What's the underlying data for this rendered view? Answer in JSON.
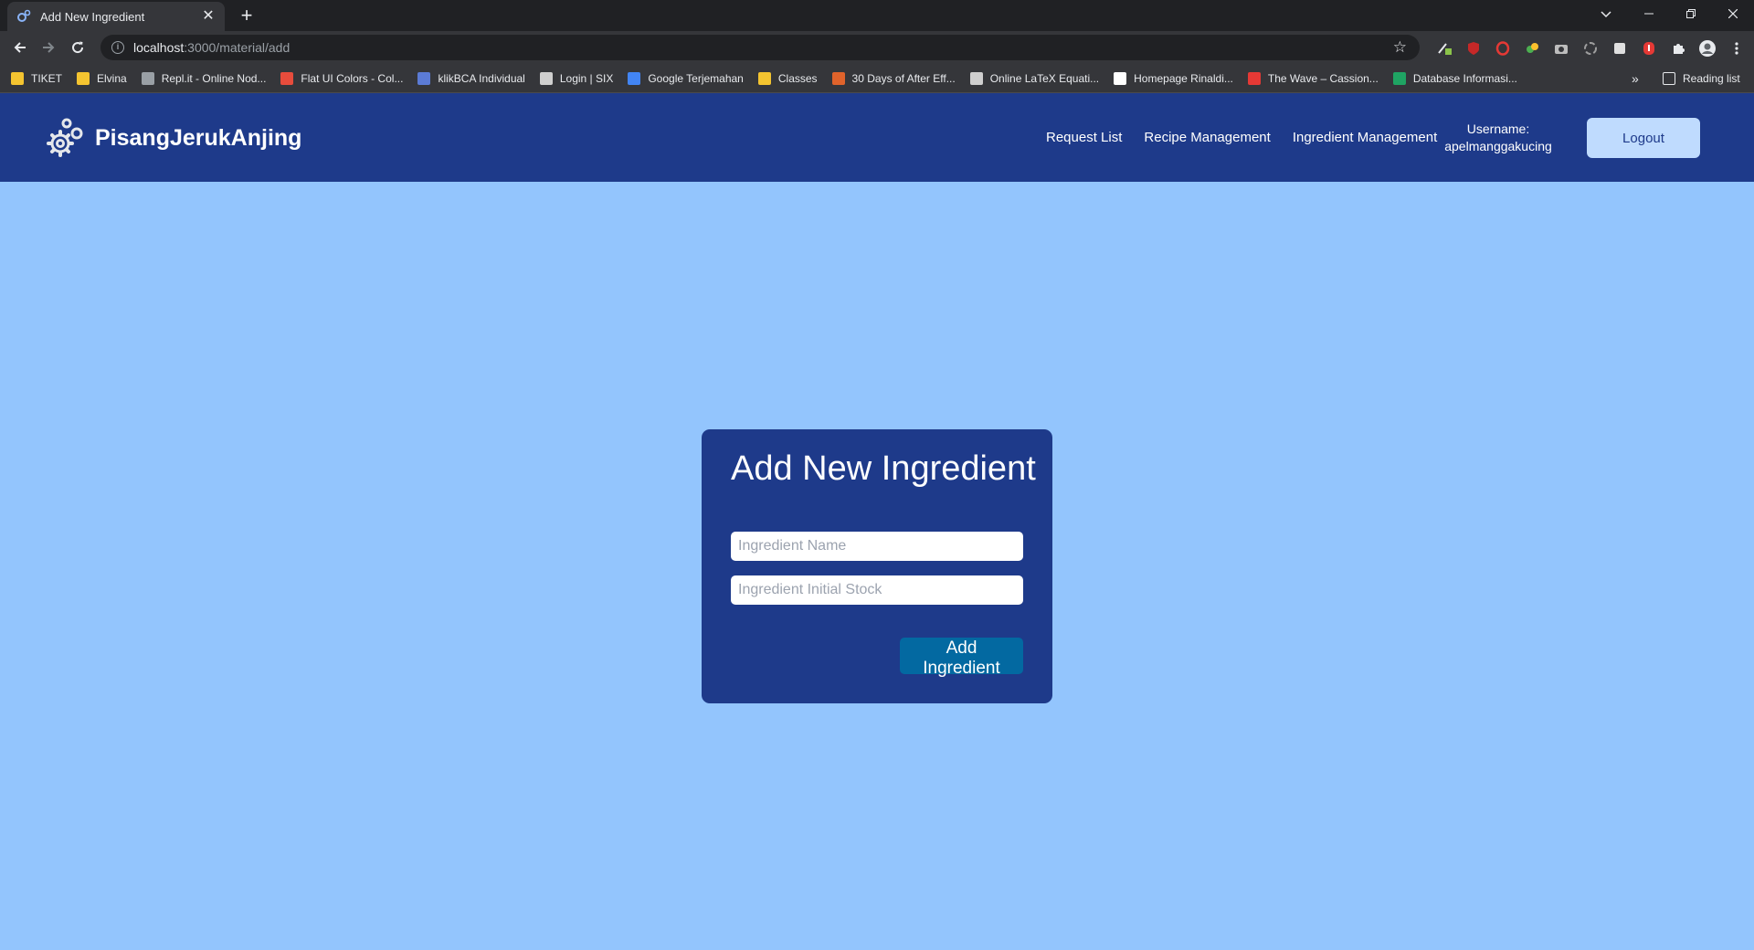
{
  "browser": {
    "tab": {
      "title": "Add New Ingredient",
      "close_glyph": "✕"
    },
    "new_tab_glyph": "+",
    "url": {
      "host": "localhost",
      "path": ":3000/material/add"
    },
    "bookmarks": [
      {
        "label": "TIKET",
        "icon": "folder-icon",
        "color": "#f4c430"
      },
      {
        "label": "Elvina",
        "icon": "folder-icon",
        "color": "#f4c430"
      },
      {
        "label": "Repl.it - Online Nod...",
        "icon": "replit-icon",
        "color": "#9aa0a6"
      },
      {
        "label": "Flat UI Colors - Col...",
        "icon": "flatui-icon",
        "color": "#e74c3c"
      },
      {
        "label": "klikBCA Individual",
        "icon": "bca-icon",
        "color": "#5b7bd5"
      },
      {
        "label": "Login | SIX",
        "icon": "six-icon",
        "color": "#cfcfcf"
      },
      {
        "label": "Google Terjemahan",
        "icon": "translate-icon",
        "color": "#4285f4"
      },
      {
        "label": "Classes",
        "icon": "classroom-icon",
        "color": "#f4c430"
      },
      {
        "label": "30 Days of After Eff...",
        "icon": "chart-icon",
        "color": "#e0632b"
      },
      {
        "label": "Online LaTeX Equati...",
        "icon": "gear-icon",
        "color": "#cfcfcf"
      },
      {
        "label": "Homepage Rinaldi...",
        "icon": "github-icon",
        "color": "#ffffff"
      },
      {
        "label": "The Wave – Cassion...",
        "icon": "wave-icon",
        "color": "#e53935"
      },
      {
        "label": "Database Informasi...",
        "icon": "sheets-icon",
        "color": "#1fa463"
      }
    ],
    "bookmarks_overflow": "»",
    "reading_list": "Reading list"
  },
  "app": {
    "brand": "PisangJerukAnjing",
    "nav": {
      "request_list": "Request List",
      "recipe_management": "Recipe Management",
      "ingredient_management": "Ingredient Management"
    },
    "user": {
      "label": "Username:",
      "name": "apelmanggakucing"
    },
    "logout": "Logout"
  },
  "form": {
    "title": "Add New Ingredient",
    "name_placeholder": "Ingredient Name",
    "name_value": "",
    "stock_placeholder": "Ingredient Initial Stock",
    "stock_value": "",
    "submit": "Add Ingredient"
  },
  "colors": {
    "page_bg": "#93c5fd",
    "navbar_bg": "#1e3a8a",
    "card_bg": "#1e3a8a",
    "logout_bg": "#bfdbfe",
    "submit_bg": "#0369a1"
  }
}
